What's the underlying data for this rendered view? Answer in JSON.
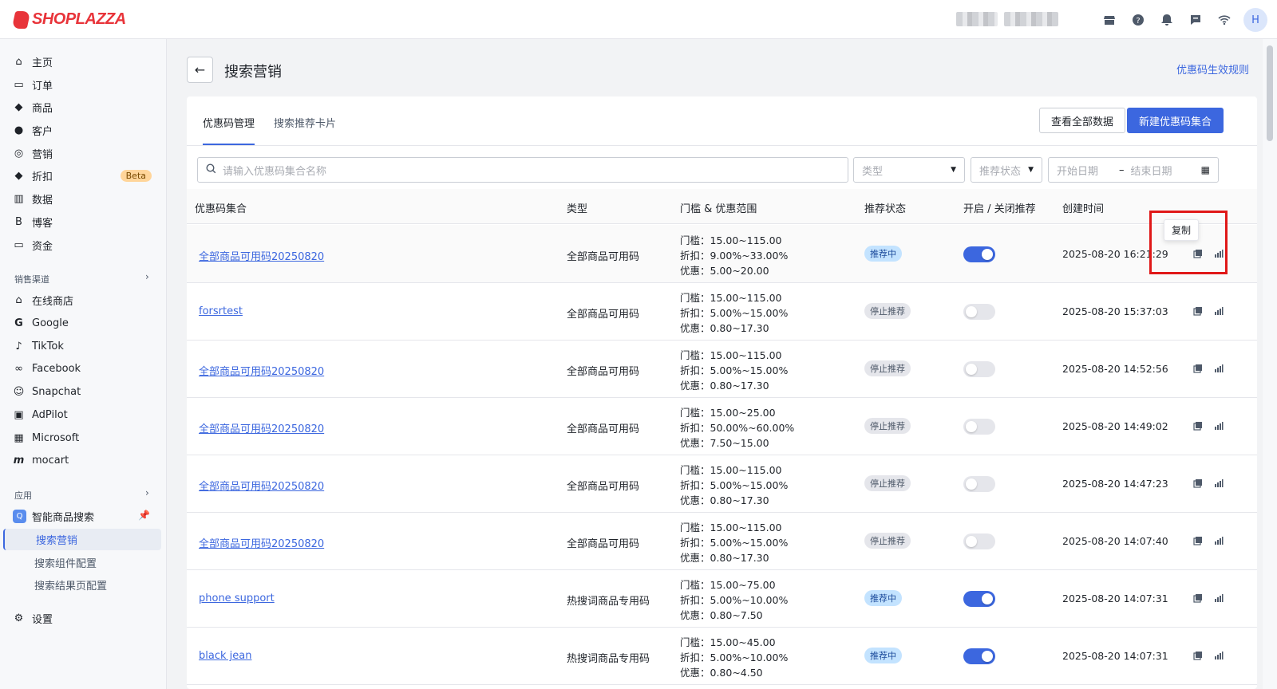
{
  "brand": {
    "name": "SHOPLAZZA",
    "color": "#e8343a"
  },
  "colors": {
    "accent": "#3c67df",
    "highlight": "#e01818"
  },
  "header": {
    "icons": [
      "storefront-icon",
      "help-icon",
      "notification-bell-icon",
      "chat-icon",
      "wifi-icon"
    ],
    "avatar_initial": "H"
  },
  "sidebar": {
    "main_items": [
      {
        "label": "主页",
        "icon": "home-icon"
      },
      {
        "label": "订单",
        "icon": "orders-icon"
      },
      {
        "label": "商品",
        "icon": "tag-icon"
      },
      {
        "label": "客户",
        "icon": "customer-icon"
      },
      {
        "label": "营销",
        "icon": "marketing-icon"
      },
      {
        "label": "折扣",
        "icon": "discount-icon",
        "badge": "Beta"
      },
      {
        "label": "数据",
        "icon": "analytics-icon"
      },
      {
        "label": "博客",
        "icon": "blog-icon"
      },
      {
        "label": "资金",
        "icon": "finance-icon"
      }
    ],
    "channels_label": "销售渠道",
    "channels": [
      {
        "label": "在线商店",
        "icon": "store-icon"
      },
      {
        "label": "Google",
        "icon": "google-icon"
      },
      {
        "label": "TikTok",
        "icon": "tiktok-icon"
      },
      {
        "label": "Facebook",
        "icon": "meta-icon"
      },
      {
        "label": "Snapchat",
        "icon": "snapchat-icon"
      },
      {
        "label": "AdPilot",
        "icon": "adpilot-icon"
      },
      {
        "label": "Microsoft",
        "icon": "microsoft-icon"
      },
      {
        "label": "mocart",
        "icon": "mocart-icon"
      }
    ],
    "apps_label": "应用",
    "app": {
      "label": "智能商品搜索",
      "icon": "smart-search-icon"
    },
    "app_sub": [
      "搜索营销",
      "搜索组件配置",
      "搜索结果页配置"
    ],
    "settings": {
      "label": "设置",
      "icon": "gear-icon"
    }
  },
  "page": {
    "title": "搜索营销",
    "rules_link": "优惠码生效规则"
  },
  "tabs": [
    {
      "label": "优惠码管理"
    },
    {
      "label": "搜索推荐卡片"
    }
  ],
  "actions": {
    "view_all": "查看全部数据",
    "create": "新建优惠码集合"
  },
  "filters": {
    "search_placeholder": "请输入优惠码集合名称",
    "type_placeholder": "类型",
    "status_placeholder": "推荐状态",
    "start_date": "开始日期",
    "date_sep": "–",
    "end_date": "结束日期"
  },
  "table": {
    "columns": [
      "优惠码集合",
      "类型",
      "门槛 & 优惠范围",
      "推荐状态",
      "开启 / 关闭推荐",
      "创建时间"
    ],
    "rows": [
      {
        "name": "全部商品可用码20250820",
        "type": "全部商品可用码",
        "threshold": "门槛：15.00~115.00",
        "discount": "折扣：9.00%~33.00%",
        "saving": "优惠：5.00~20.00",
        "status": "推荐中",
        "on": true,
        "created": "2025-08-20 16:21:29"
      },
      {
        "name": "forsrtest",
        "type": "全部商品可用码",
        "threshold": "门槛：15.00~115.00",
        "discount": "折扣：5.00%~15.00%",
        "saving": "优惠：0.80~17.30",
        "status": "停止推荐",
        "on": false,
        "created": "2025-08-20 15:37:03"
      },
      {
        "name": "全部商品可用码20250820",
        "type": "全部商品可用码",
        "threshold": "门槛：15.00~115.00",
        "discount": "折扣：5.00%~15.00%",
        "saving": "优惠：0.80~17.30",
        "status": "停止推荐",
        "on": false,
        "created": "2025-08-20 14:52:56"
      },
      {
        "name": "全部商品可用码20250820",
        "type": "全部商品可用码",
        "threshold": "门槛：15.00~25.00",
        "discount": "折扣：50.00%~60.00%",
        "saving": "优惠：7.50~15.00",
        "status": "停止推荐",
        "on": false,
        "created": "2025-08-20 14:49:02"
      },
      {
        "name": "全部商品可用码20250820",
        "type": "全部商品可用码",
        "threshold": "门槛：15.00~115.00",
        "discount": "折扣：5.00%~15.00%",
        "saving": "优惠：0.80~17.30",
        "status": "停止推荐",
        "on": false,
        "created": "2025-08-20 14:47:23"
      },
      {
        "name": "全部商品可用码20250820",
        "type": "全部商品可用码",
        "threshold": "门槛：15.00~115.00",
        "discount": "折扣：5.00%~15.00%",
        "saving": "优惠：0.80~17.30",
        "status": "停止推荐",
        "on": false,
        "created": "2025-08-20 14:07:40"
      },
      {
        "name": "phone support",
        "type": "热搜词商品专用码",
        "threshold": "门槛：15.00~75.00",
        "discount": "折扣：5.00%~10.00%",
        "saving": "优惠：0.80~7.50",
        "status": "推荐中",
        "on": true,
        "created": "2025-08-20 14:07:31"
      },
      {
        "name": "black jean",
        "type": "热搜词商品专用码",
        "threshold": "门槛：15.00~45.00",
        "discount": "折扣：5.00%~10.00%",
        "saving": "优惠：0.80~4.50",
        "status": "推荐中",
        "on": true,
        "created": "2025-08-20 14:07:31"
      }
    ],
    "row_actions": [
      "copy-icon",
      "chart-icon"
    ]
  },
  "tooltip": {
    "text": "复制"
  }
}
